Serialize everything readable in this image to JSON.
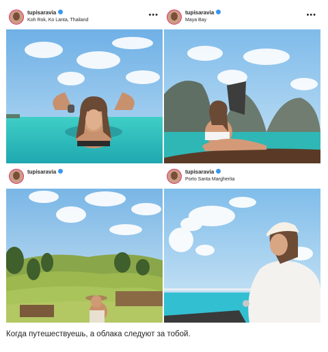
{
  "posts": [
    {
      "username": "tupisaravia",
      "location": "Koh Rok, Ko Lanta, Thailand",
      "more": "•••"
    },
    {
      "username": "tupisaravia",
      "location": "Maya Bay",
      "more": "•••"
    },
    {
      "username": "tupisaravia",
      "location": "",
      "more": ""
    },
    {
      "username": "tupisaravia",
      "location": "Porto Santa Margherita",
      "more": ""
    }
  ],
  "caption": "Когда путешествуешь, а облака следуют за тобой.",
  "colors": {
    "sky": "#7db6e8",
    "sea": "#33c6c0",
    "verified": "#3897f0"
  },
  "icons": {
    "verified": "verified-badge-icon",
    "more": "more-options-icon",
    "bookmark": "bookmark-icon"
  }
}
